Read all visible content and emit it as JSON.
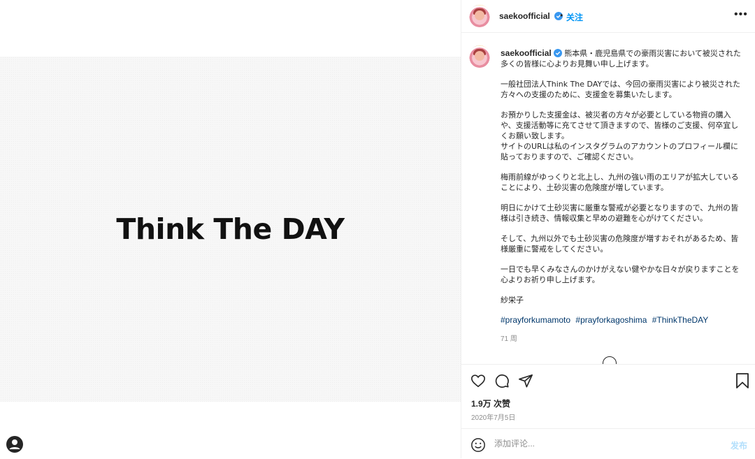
{
  "post": {
    "image_text": "Think The DAY"
  },
  "header": {
    "username": "saekoofficial",
    "separator": "•",
    "follow_label": "关注",
    "more_label": "•••"
  },
  "caption": {
    "username": "saekoofficial",
    "paragraphs": [
      "熊本県・鹿児島県での豪雨災害において被災された多くの皆様に心よりお見舞い申し上げます。",
      "一般社団法人Think The DAYでは、今回の豪雨災害により被災された方々への支援のために、支援金を募集いたします。",
      "お預かりした支援金は、被災者の方々が必要としている物資の購入や、支援活動等に充てさせて頂きますので、皆様のご支援、何卒宜しくお願い致します。\nサイトのURLは私のインスタグラムのアカウントのプロフィール欄に貼っておりますので、ご確認ください。",
      "梅雨前線がゆっくりと北上し、九州の強い雨のエリアが拡大していることにより、土砂災害の危険度が増しています。",
      "明日にかけて土砂災害に厳重な警戒が必要となりますので、九州の皆様は引き続き、情報収集と早めの避難を心がけてください。",
      "そして、九州以外でも土砂災害の危険度が増すおそれがあるため、皆様厳重に警戒をしてください。",
      "一日でも早くみなさんのかけがえない健やかな日々が戻りますことを心よりお祈り申し上げます。",
      "紗栄子"
    ],
    "hashtags": [
      "#prayforkumamoto",
      "#prayforkagoshima",
      "#ThinkTheDAY"
    ],
    "time_ago": "71 周"
  },
  "stats": {
    "likes": "1.9万 次赞",
    "date": "2020年7月5日"
  },
  "comment_box": {
    "placeholder": "添加评论...",
    "post_label": "发布"
  },
  "colors": {
    "accent": "#0095f6",
    "hashtag": "#00376b",
    "muted": "#8e8e8e",
    "post_disabled": "#b2dffc"
  },
  "icons": [
    "user-icon",
    "verified-badge-icon",
    "more-options-icon",
    "like-heart-icon",
    "comment-icon",
    "share-icon",
    "save-bookmark-icon",
    "emoji-icon",
    "load-more-comments-icon"
  ]
}
